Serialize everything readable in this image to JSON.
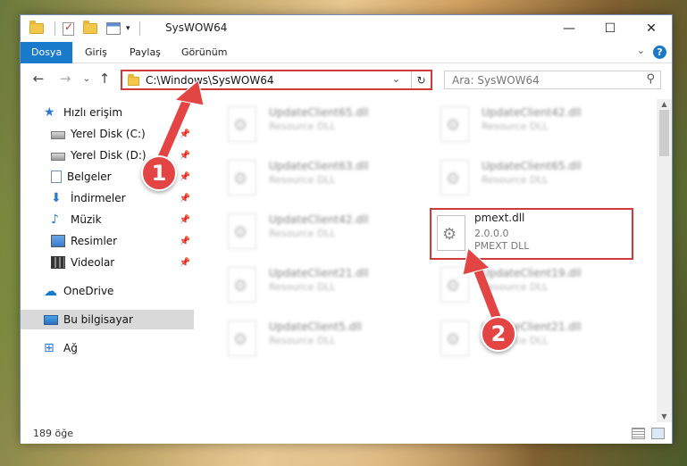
{
  "window": {
    "title": "SysWOW64",
    "minimize_icon": "—",
    "maximize_icon": "☐",
    "close_icon": "✕"
  },
  "ribbon": {
    "tabs": [
      {
        "label": "Dosya",
        "active": true
      },
      {
        "label": "Giriş"
      },
      {
        "label": "Paylaş"
      },
      {
        "label": "Görünüm"
      }
    ],
    "help_icon": "?",
    "expand_icon": "⌄"
  },
  "nav": {
    "back": "←",
    "forward": "→",
    "recent": "⌄",
    "up": "↑",
    "address_path": "C:\\Windows\\SysWOW64",
    "address_dropdown": "⌄",
    "refresh": "↻",
    "search_placeholder": "Ara: SysWOW64",
    "search_icon": "⚲"
  },
  "sidebar": {
    "items": [
      {
        "label": "Hızlı erişim",
        "icon": "star-icon",
        "pinned": false
      },
      {
        "label": "Yerel Disk (C:)",
        "icon": "disk-icon",
        "pinned": true
      },
      {
        "label": "Yerel Disk (D:)",
        "icon": "disk-icon",
        "pinned": true
      },
      {
        "label": "Belgeler",
        "icon": "document-icon",
        "pinned": true
      },
      {
        "label": "İndirmeler",
        "icon": "download-icon",
        "pinned": true
      },
      {
        "label": "Müzik",
        "icon": "music-icon",
        "pinned": true
      },
      {
        "label": "Resimler",
        "icon": "pictures-icon",
        "pinned": true
      },
      {
        "label": "Videolar",
        "icon": "videos-icon",
        "pinned": true
      },
      {
        "label": "OneDrive",
        "icon": "cloud-icon",
        "pinned": false
      },
      {
        "label": "Bu bilgisayar",
        "icon": "computer-icon",
        "pinned": false,
        "selected": true
      },
      {
        "label": "Ağ",
        "icon": "network-icon",
        "pinned": false
      }
    ],
    "pin_glyph": "📌",
    "star_glyph": "★",
    "download_glyph": "⬇",
    "music_glyph": "♪",
    "cloud_glyph": "☁",
    "network_glyph": "⊞"
  },
  "files": [
    {
      "name": "UpdateClient65.dll",
      "desc": "Resource DLL"
    },
    {
      "name": "UpdateClient42.dll",
      "desc": "Resource DLL"
    },
    {
      "name": "UpdateClient63.dll",
      "desc": "Resource DLL"
    },
    {
      "name": "UpdateClient65.dll",
      "desc": "Resource DLL"
    },
    {
      "name": "UpdateClient42.dll",
      "desc": "Resource DLL"
    },
    {
      "name": "pmext.dll",
      "version": "2.0.0.0",
      "desc": "PMEXT DLL"
    },
    {
      "name": "UpdateClient21.dll",
      "desc": "Resource DLL"
    },
    {
      "name": "UpdateClient19.dll",
      "desc": "Resource DLL"
    },
    {
      "name": "UpdateClient5.dll",
      "desc": "Resource DLL"
    },
    {
      "name": "UpdateClient21.dll",
      "desc": "Resource DLL"
    }
  ],
  "status": {
    "count": "189 öğe"
  },
  "annotations": [
    {
      "number": "1"
    },
    {
      "number": "2"
    }
  ],
  "colors": {
    "accent": "#1979ca",
    "highlight": "#d03a3a",
    "annotation": "#e34444"
  }
}
